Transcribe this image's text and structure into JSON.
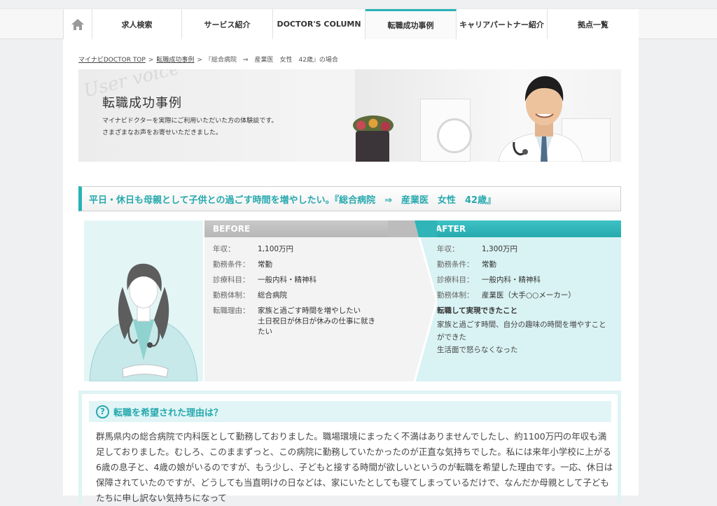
{
  "nav": {
    "home_icon": "home-icon",
    "items": [
      {
        "label": "求人検索"
      },
      {
        "label": "サービス紹介"
      },
      {
        "label": "DOCTOR'S COLUMN"
      },
      {
        "label": "転職成功事例",
        "active": true
      },
      {
        "label": "キャリアパートナー紹介"
      },
      {
        "label": "拠点一覧"
      }
    ]
  },
  "breadcrumb": {
    "items": [
      "マイナビDOCTOR TOP",
      "転職成功事例"
    ],
    "current": "『総合病院　⇒　産業医　女性　42歳』の場合",
    "separator": ">"
  },
  "hero": {
    "script_text": "User voice",
    "title": "転職成功事例",
    "desc_line1": "マイナビドクターを実際にご利用いただいた方の体験談です。",
    "desc_line2": "さまざまなお声をお寄せいただきました。"
  },
  "catch": {
    "text": "平日・休日も母親として子供との過ごす時間を増やしたい。『総合病院　⇒　産業医　女性　42歳』"
  },
  "before": {
    "heading": "BEFORE",
    "rows": [
      {
        "key": "年収：",
        "value": "1,100万円"
      },
      {
        "key": "勤務条件：",
        "value": "常勤"
      },
      {
        "key": "診療科目：",
        "value": "一般内科・精神科"
      },
      {
        "key": "勤務体制：",
        "value": "総合病院"
      },
      {
        "key": "転職理由：",
        "value": "家族と過ごす時間を増やしたい\n土日祝日が休日が休みの仕事に就きたい"
      }
    ]
  },
  "after": {
    "heading": "AFTER",
    "rows": [
      {
        "key": "年収：",
        "value": "1,300万円"
      },
      {
        "key": "勤務条件：",
        "value": "常勤"
      },
      {
        "key": "診療科目：",
        "value": "一般内科・精神科"
      },
      {
        "key": "勤務体制：",
        "value": "産業医（大手○○メーカー）"
      }
    ],
    "sub_heading": "転職して実現できたこと",
    "text": "家族と過ごす時間、自分の趣味の時間を増やすことができた\n生活面で怒らなくなった"
  },
  "reason": {
    "icon": "question-icon",
    "title": "転職を希望された理由は？",
    "body": "群馬県内の総合病院で内科医として勤務しておりました。職場環境にまったく不満はありませんでしたし、約1100万円の年収も満足しておりました。むしろ、このままずっと、この病院に勤務していたかったのが正直な気持ちでした。私には来年小学校に上がる6歳の息子と、4歳の娘がいるのですが、もう少し、子どもと接する時間が欲しいというのが転職を希望した理由です。一応、休日は保障されていたのですが、どうしても当直明けの日などは、家にいたとしても寝てしまっているだけで、なんだか母親として子どもたちに申し訳ない気持ちになって"
  },
  "colors": {
    "accent": "#27a9ae",
    "before_head": "#b7b7b7",
    "after_bg": "#d9f2f3"
  }
}
